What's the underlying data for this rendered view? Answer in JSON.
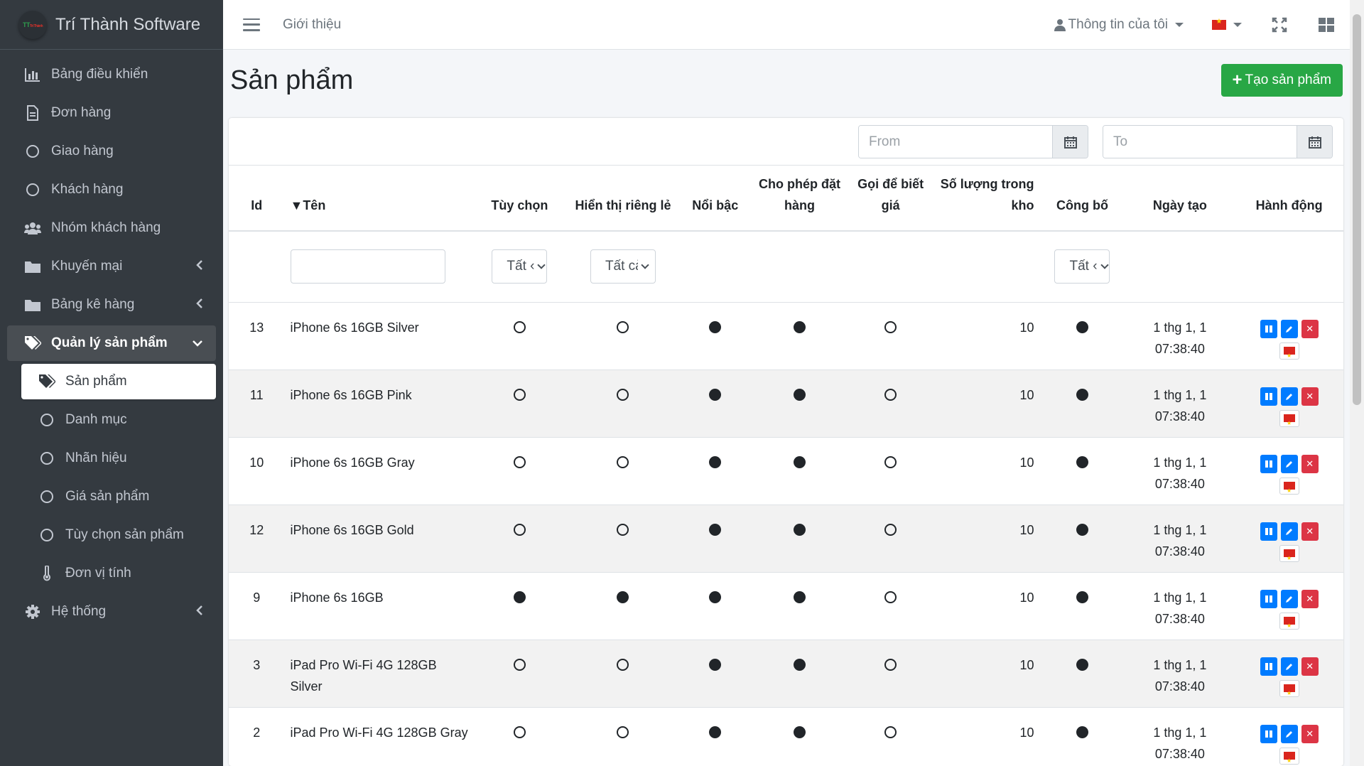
{
  "brand": {
    "name": "Trí Thành Software",
    "logo_text_a": "TT",
    "logo_text_b": "Trí Thành"
  },
  "sidebar": {
    "items": [
      {
        "label": "Bảng điều khiển",
        "icon": "chart-bar-icon"
      },
      {
        "label": "Đơn hàng",
        "icon": "file-icon"
      },
      {
        "label": "Giao hàng",
        "icon": "circle-icon"
      },
      {
        "label": "Khách hàng",
        "icon": "circle-icon"
      },
      {
        "label": "Nhóm khách hàng",
        "icon": "users-icon"
      },
      {
        "label": "Khuyến mại",
        "icon": "folder-icon"
      },
      {
        "label": "Bảng kê hàng",
        "icon": "folder-icon"
      },
      {
        "label": "Quản lý sản phẩm",
        "icon": "tags-icon"
      },
      {
        "label": "Sản phẩm",
        "icon": "tags-icon"
      },
      {
        "label": "Danh mục",
        "icon": "circle-icon"
      },
      {
        "label": "Nhãn hiệu",
        "icon": "circle-icon"
      },
      {
        "label": "Giá sản phẩm",
        "icon": "circle-icon"
      },
      {
        "label": "Tùy chọn sản phẩm",
        "icon": "circle-icon"
      },
      {
        "label": "Đơn vị tính",
        "icon": "thermometer-icon"
      },
      {
        "label": "Hệ thống",
        "icon": "gear-icon"
      }
    ]
  },
  "topbar": {
    "link": "Giới thiệu",
    "user_menu": "Thông tin của tôi"
  },
  "page": {
    "title": "Sản phẩm",
    "create_button": "Tạo sản phẩm"
  },
  "filters": {
    "from_placeholder": "From",
    "to_placeholder": "To",
    "select_all_short": "Tất ‹",
    "select_all": "Tất cả"
  },
  "table": {
    "headers": {
      "id": "Id",
      "name": "▼Tên",
      "option": "Tùy chọn",
      "visible_individually": "Hiển thị riêng lẻ",
      "featured": "Nổi bậc",
      "allow_order": "Cho phép đặt hàng",
      "call_for_price": "Gọi để biết giá",
      "stock": "Số lượng trong kho",
      "published": "Công bố",
      "created": "Ngày tạo",
      "actions": "Hành động"
    },
    "rows": [
      {
        "id": "13",
        "name": "iPhone 6s 16GB Silver",
        "option": false,
        "visible": false,
        "featured": true,
        "allow_order": true,
        "call_price": false,
        "stock": "10",
        "published": true,
        "created": "1 thg 1, 1 07:38:40"
      },
      {
        "id": "11",
        "name": "iPhone 6s 16GB Pink",
        "option": false,
        "visible": false,
        "featured": true,
        "allow_order": true,
        "call_price": false,
        "stock": "10",
        "published": true,
        "created": "1 thg 1, 1 07:38:40"
      },
      {
        "id": "10",
        "name": "iPhone 6s 16GB Gray",
        "option": false,
        "visible": false,
        "featured": true,
        "allow_order": true,
        "call_price": false,
        "stock": "10",
        "published": true,
        "created": "1 thg 1, 1 07:38:40"
      },
      {
        "id": "12",
        "name": "iPhone 6s 16GB Gold",
        "option": false,
        "visible": false,
        "featured": true,
        "allow_order": true,
        "call_price": false,
        "stock": "10",
        "published": true,
        "created": "1 thg 1, 1 07:38:40"
      },
      {
        "id": "9",
        "name": "iPhone 6s 16GB",
        "option": true,
        "visible": true,
        "featured": true,
        "allow_order": true,
        "call_price": false,
        "stock": "10",
        "published": true,
        "created": "1 thg 1, 1 07:38:40"
      },
      {
        "id": "3",
        "name": "iPad Pro Wi-Fi 4G 128GB Silver",
        "option": false,
        "visible": false,
        "featured": true,
        "allow_order": true,
        "call_price": false,
        "stock": "10",
        "published": true,
        "created": "1 thg 1, 1 07:38:40"
      },
      {
        "id": "2",
        "name": "iPad Pro Wi-Fi 4G 128GB Gray",
        "option": false,
        "visible": false,
        "featured": true,
        "allow_order": true,
        "call_price": false,
        "stock": "10",
        "published": true,
        "created": "1 thg 1, 1 07:38:40"
      }
    ]
  },
  "colors": {
    "sidebar": "#343a40",
    "success": "#28a745",
    "primary": "#007bff",
    "danger": "#dc3545"
  }
}
